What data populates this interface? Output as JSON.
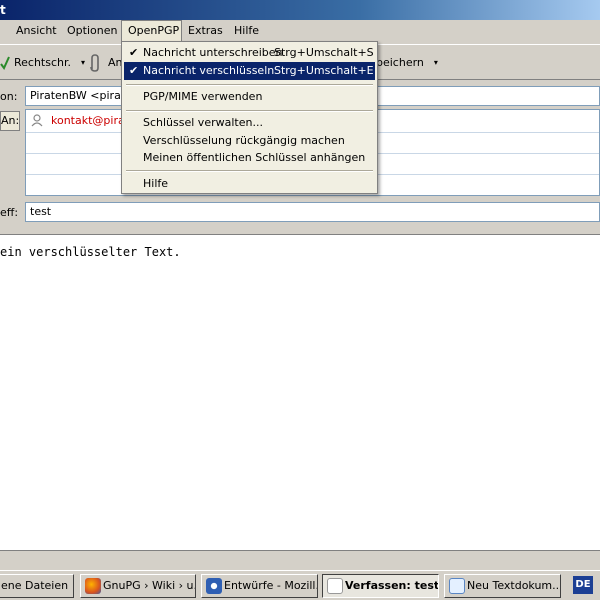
{
  "window": {
    "title": "t"
  },
  "menubar": [
    {
      "label": "Ansicht"
    },
    {
      "label": "Optionen"
    },
    {
      "label": "OpenPGP"
    },
    {
      "label": "Extras"
    },
    {
      "label": "Hilfe"
    }
  ],
  "toolbar": {
    "spell_label": "Rechtschr.",
    "attach_label": "An",
    "save_label": "peichern"
  },
  "compose": {
    "from_label": "on:",
    "from_value": "PiratenBW <piraten",
    "to_label": "An:",
    "to_value": "kontakt@pirat",
    "subject_label": "eff:",
    "subject_value": "test",
    "body": "ein verschlüsselter Text."
  },
  "openpgp_menu": {
    "sign": {
      "label": "Nachricht unterschreiben",
      "shortcut": "Strg+Umschalt+S",
      "checked": true
    },
    "encrypt": {
      "label": "Nachricht verschlüsseln",
      "shortcut": "Strg+Umschalt+E",
      "checked": true
    },
    "pgpmime": {
      "label": "PGP/MIME verwenden"
    },
    "manage_keys": {
      "label": "Schlüssel verwalten..."
    },
    "undo_encryption": {
      "label": "Verschlüsselung rückgängig machen"
    },
    "attach_key": {
      "label": "Meinen öffentlichen Schlüssel anhängen"
    },
    "help": {
      "label": "Hilfe"
    },
    "check_glyph": "✔"
  },
  "taskbar": {
    "items": [
      {
        "label": "ene Dateien"
      },
      {
        "label": "GnuPG › Wiki › u..."
      },
      {
        "label": "Entwürfe - Mozill..."
      },
      {
        "label": "Verfassen: test"
      },
      {
        "label": "Neu Textdokum..."
      }
    ],
    "language": "DE"
  },
  "colors": {
    "menu_highlight": "#0a246a",
    "recipient_red": "#cc0000",
    "title_blue": "#0a246a"
  }
}
